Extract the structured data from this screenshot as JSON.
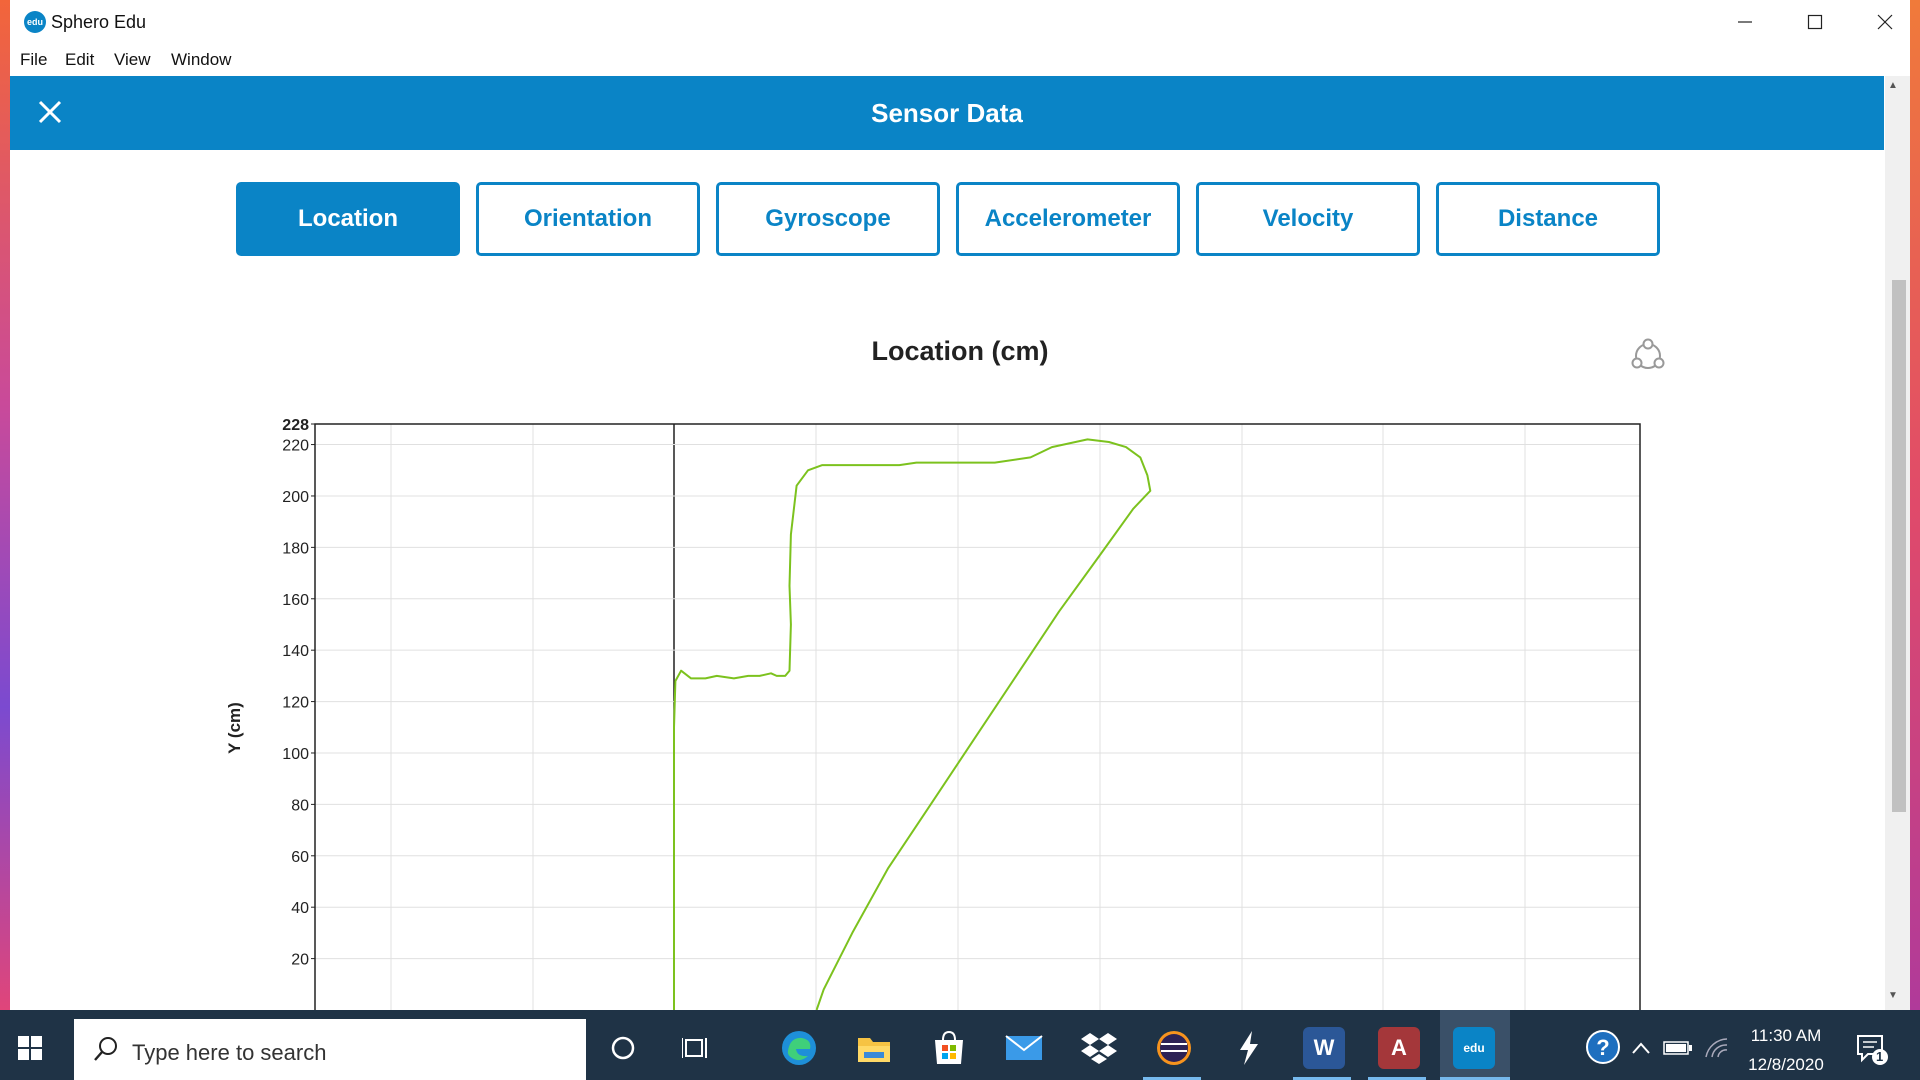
{
  "window": {
    "app_title": "Sphero Edu",
    "logo_text": "edu"
  },
  "menu": [
    "File",
    "Edit",
    "View",
    "Window"
  ],
  "header": {
    "title": "Sensor Data"
  },
  "tabs": [
    {
      "label": "Location",
      "active": true
    },
    {
      "label": "Orientation",
      "active": false
    },
    {
      "label": "Gyroscope",
      "active": false
    },
    {
      "label": "Accelerometer",
      "active": false
    },
    {
      "label": "Velocity",
      "active": false
    },
    {
      "label": "Distance",
      "active": false
    }
  ],
  "chart_data": {
    "type": "line",
    "title": "Location (cm)",
    "ylabel": "Y (cm)",
    "xlabel": "",
    "ylim": [
      0,
      228
    ],
    "y_ticks": [
      228,
      220,
      200,
      180,
      160,
      140,
      120,
      100,
      80,
      60,
      40,
      20
    ],
    "grid": true,
    "series": [
      {
        "color": "#7cc21e",
        "points": [
          [
            0,
            0
          ],
          [
            0,
            40
          ],
          [
            0,
            110
          ],
          [
            1,
            128
          ],
          [
            5,
            132
          ],
          [
            12,
            129
          ],
          [
            22,
            129
          ],
          [
            30,
            130
          ],
          [
            42,
            129
          ],
          [
            52,
            130
          ],
          [
            60,
            130
          ],
          [
            68,
            131
          ],
          [
            72,
            130
          ],
          [
            78,
            130
          ],
          [
            81,
            132
          ],
          [
            82,
            150
          ],
          [
            81,
            165
          ],
          [
            82,
            185
          ],
          [
            86,
            204
          ],
          [
            94,
            210
          ],
          [
            104,
            212
          ],
          [
            130,
            212
          ],
          [
            158,
            212
          ],
          [
            170,
            213
          ],
          [
            200,
            213
          ],
          [
            225,
            213
          ],
          [
            250,
            215
          ],
          [
            265,
            219
          ],
          [
            290,
            222
          ],
          [
            305,
            221
          ],
          [
            317,
            219
          ],
          [
            327,
            215
          ],
          [
            332,
            208
          ],
          [
            334,
            202
          ],
          [
            322,
            195
          ],
          [
            300,
            178
          ],
          [
            270,
            155
          ],
          [
            240,
            130
          ],
          [
            210,
            105
          ],
          [
            180,
            80
          ],
          [
            150,
            55
          ],
          [
            125,
            30
          ],
          [
            105,
            8
          ],
          [
            100,
            0
          ]
        ]
      }
    ]
  },
  "taskbar": {
    "search_placeholder": "Type here to search",
    "time": "11:30 AM",
    "date": "12/8/2020",
    "notification_count": "1",
    "word_label": "W",
    "access_label": "A",
    "edu_label": "edu"
  }
}
